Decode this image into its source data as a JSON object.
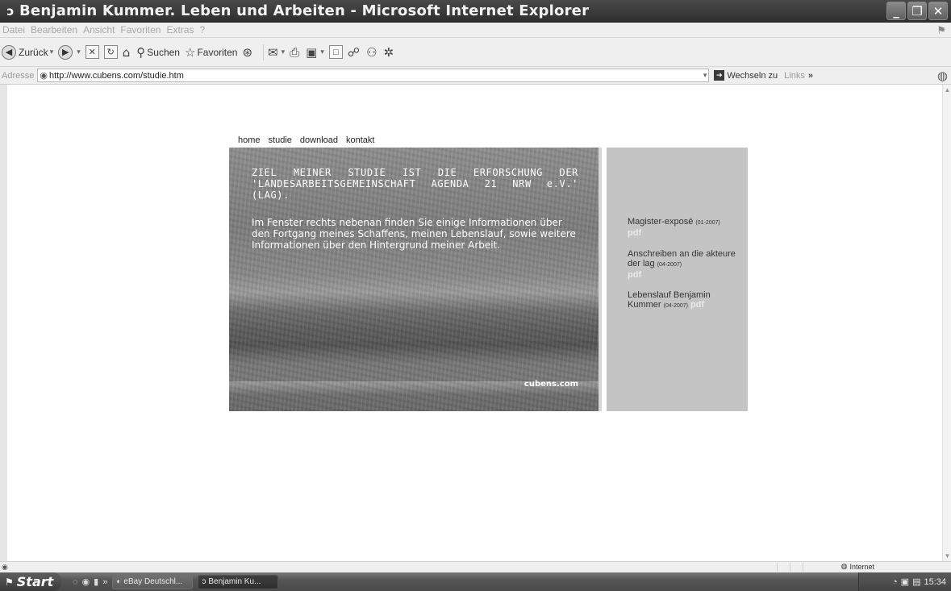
{
  "window": {
    "title": "Benjamin Kummer. Leben und Arbeiten - Microsoft Internet Explorer",
    "minimize": "_",
    "maximize": "❐",
    "close": "✕"
  },
  "menu": {
    "items": [
      "Datei",
      "Bearbeiten",
      "Ansicht",
      "Favoriten",
      "Extras",
      "?"
    ]
  },
  "toolbar": {
    "back_label": "Zurück",
    "search_label": "Suchen",
    "favorites_label": "Favoriten"
  },
  "address": {
    "label": "Adresse",
    "url": "http://www.cubens.com/studie.htm",
    "go_label": "Wechseln zu",
    "links_label": "Links",
    "chevron": "»"
  },
  "page": {
    "nav": [
      "home",
      "studie",
      "download",
      "kontakt"
    ],
    "hero_heading": "ZIEL MEINER STUDIE IST DIE ERFORSCHUNG DER 'LANDESARBEITSGEMEINSCHAFT AGENDA 21 NRW e.V.' (LAG).",
    "hero_body": "Im Fenster rechts nebenan finden Sie einige Informationen über den Fortgang meines Schaffens, meinen Lebenslauf, sowie weitere Informationen über den Hintergrund meiner Arbeit.",
    "hero_domain": "cubens.com",
    "documents": [
      {
        "title": "Magister-exposé",
        "date": "(01-2007)",
        "link": "pdf"
      },
      {
        "title": "Anschreiben an die akteure der lag",
        "date": "(04-2007)",
        "link": "pdf"
      },
      {
        "title": "Lebenslauf Benjamin Kummer",
        "date": "(04-2007)",
        "link": "pdf"
      }
    ]
  },
  "status": {
    "zone": "Internet"
  },
  "taskbar": {
    "start_label": "Start",
    "tasks": [
      "eBay Deutschl...",
      "Benjamin Ku..."
    ],
    "clock": "15:34"
  },
  "colors": {
    "titlebar": "#3a3a3a",
    "sidebox": "#c4c4c4",
    "pdf_link": "#eaeaea"
  }
}
